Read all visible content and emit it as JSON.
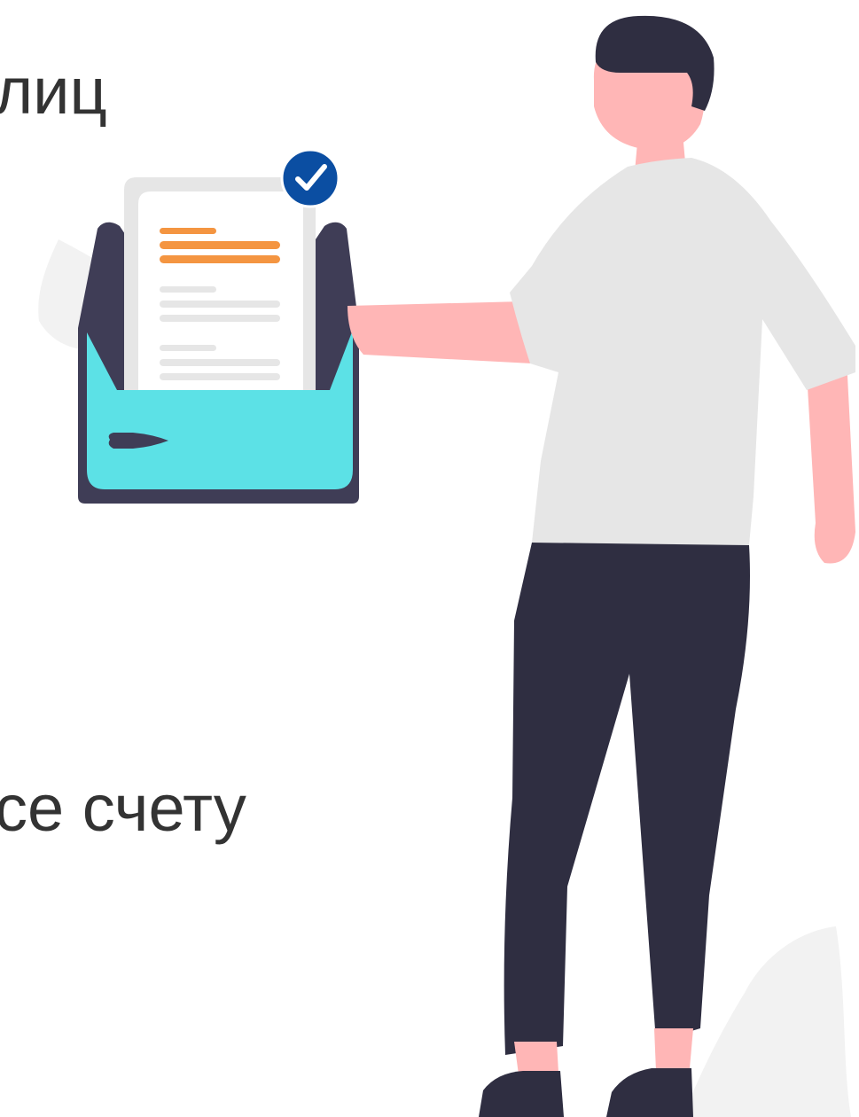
{
  "texts": {
    "top_fragment": "лиц",
    "bottom_fragment": "се счету"
  },
  "icons": {
    "check_badge": "checkmark-icon"
  },
  "colors": {
    "background": "#ffffff",
    "text": "#333333",
    "tray_dark": "#3f3d56",
    "tray_teal": "#5ce1e6",
    "accent_orange": "#f49541",
    "check_blue": "#0b4ea2",
    "skin": "#ffb6b6",
    "hair": "#2f2e41",
    "shirt": "#e6e6e6",
    "pants": "#2f2e41",
    "leaf": "#f2f2f2"
  }
}
